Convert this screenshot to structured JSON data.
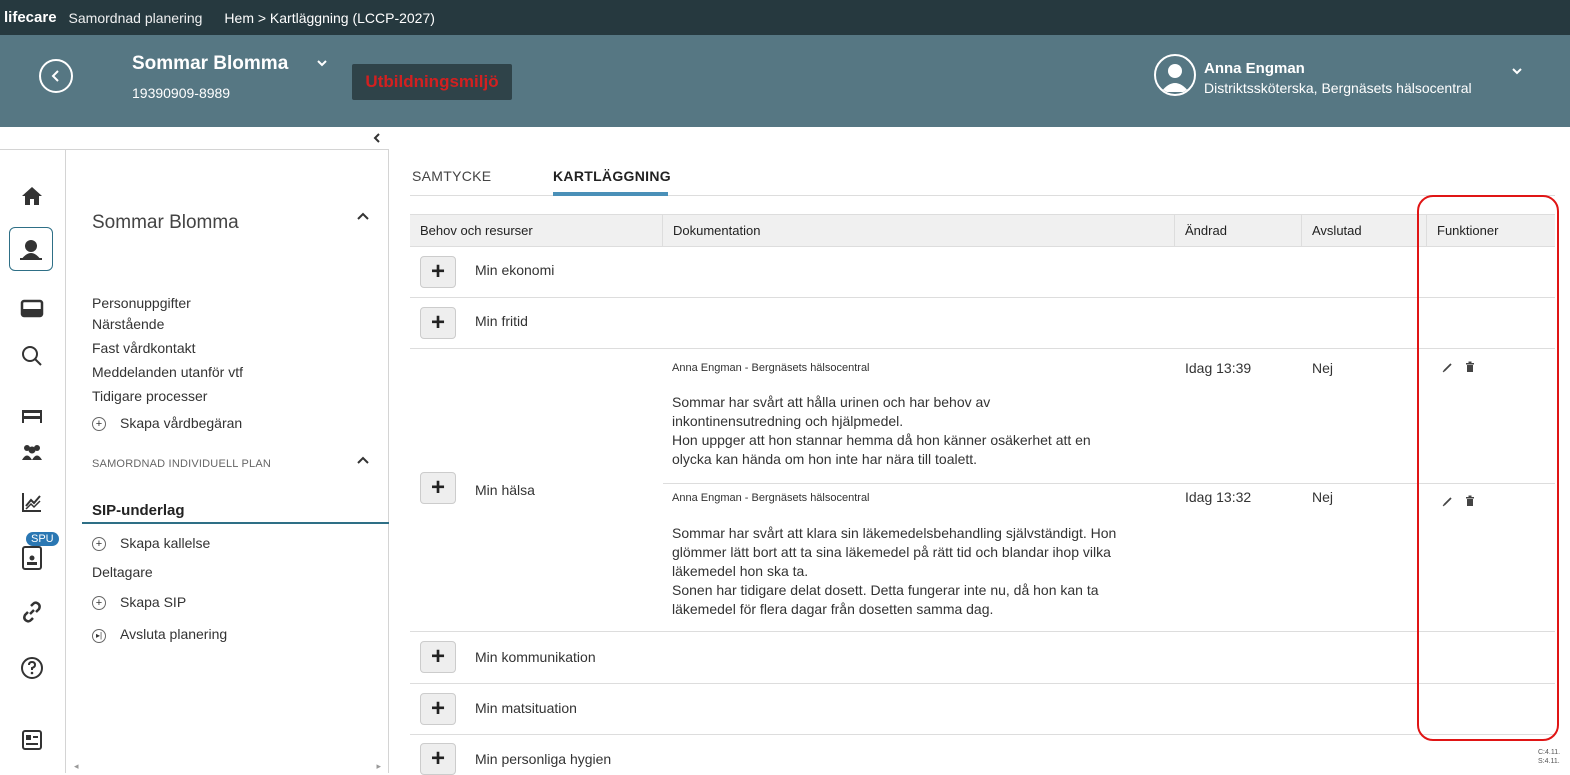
{
  "topbar": {
    "brand": "lifecare",
    "app": "Samordnad planering",
    "breadcrumb": "Hem > Kartläggning (LCCP-2027)"
  },
  "patient": {
    "name": "Sommar Blomma",
    "personnummer": "19390909-8989",
    "environment_badge": "Utbildningsmiljö"
  },
  "user": {
    "name": "Anna Engman",
    "role": "Distriktssköterska, Bergnäsets hälsocentral"
  },
  "rail": {
    "badge": "SPU"
  },
  "sidebar": {
    "title": "Sommar Blomma",
    "items": [
      "Personuppgifter",
      "Närstående",
      "Fast vårdkontakt",
      "Meddelanden utanför vtf",
      "Tidigare processer"
    ],
    "create_request": "Skapa vårdbegäran",
    "section_title": "SAMORDNAD INDIVIDUELL PLAN",
    "active_item": "SIP-underlag",
    "sip_items": {
      "create_invite": "Skapa kallelse",
      "participants": "Deltagare",
      "create_sip": "Skapa SIP",
      "end_planning": "Avsluta planering"
    }
  },
  "tabs": [
    "SAMTYCKE",
    "KARTLÄGGNING"
  ],
  "table": {
    "headers": [
      "Behov och resurser",
      "Dokumentation",
      "Ändrad",
      "Avslutad",
      "Funktioner"
    ],
    "rows": [
      {
        "label": "Min ekonomi"
      },
      {
        "label": "Min fritid"
      },
      {
        "label": "Min hälsa",
        "entries": [
          {
            "author": "Anna Engman - Bergnäsets hälsocentral",
            "text": [
              "Sommar har svårt att hålla urinen och har behov av",
              "inkontinensutredning och hjälpmedel.",
              "Hon uppger att hon stannar hemma då hon känner osäkerhet att en",
              "olycka kan hända om hon inte har nära till toalett."
            ],
            "changed": "Idag 13:39",
            "closed": "Nej"
          },
          {
            "author": "Anna Engman - Bergnäsets hälsocentral",
            "text": [
              "Sommar har svårt att klara sin läkemedelsbehandling självständigt. Hon",
              "glömmer lätt bort att ta sina läkemedel på rätt tid och blandar ihop vilka",
              "läkemedel hon ska ta.",
              "Sonen har tidigare delat dosett. Detta fungerar inte nu, då hon kan ta",
              "läkemedel för flera dagar från dosetten samma dag."
            ],
            "changed": "Idag 13:32",
            "closed": "Nej"
          }
        ]
      },
      {
        "label": "Min kommunikation"
      },
      {
        "label": "Min matsituation"
      },
      {
        "label": "Min personliga hygien"
      }
    ]
  },
  "version": [
    "C:4.11.",
    "S:4.11."
  ],
  "colors": {
    "topbar": "#26393f",
    "header": "#567783",
    "accent": "#4a90b8",
    "highlight": "#e01515"
  }
}
